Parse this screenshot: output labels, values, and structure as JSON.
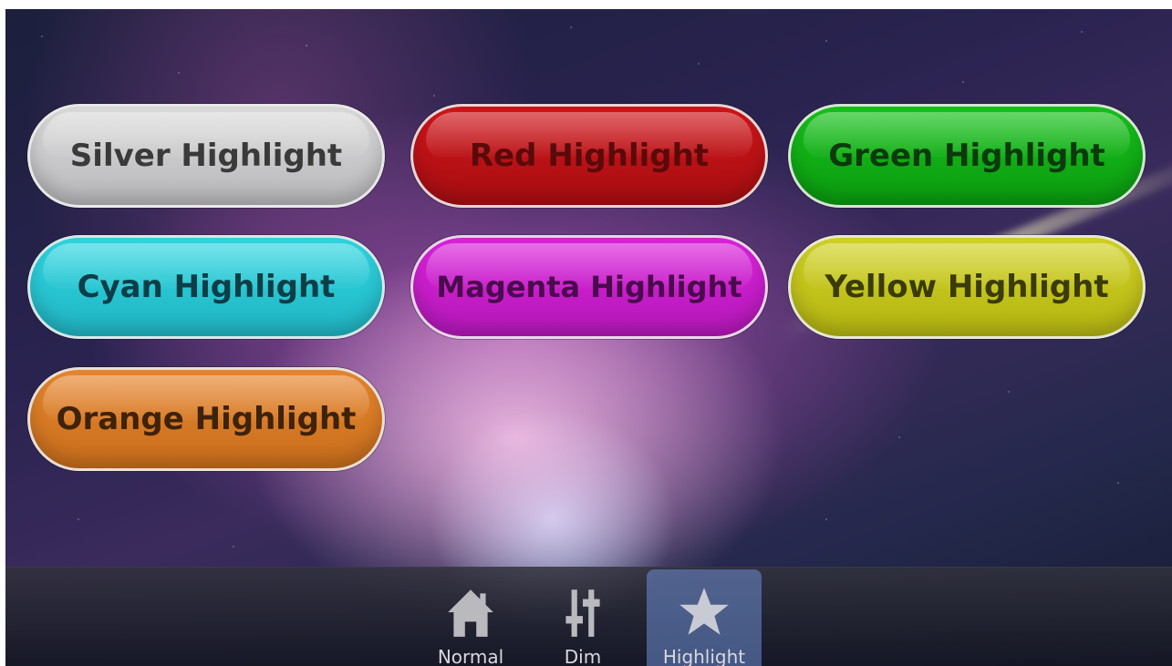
{
  "buttons": [
    {
      "label": "Silver Highlight",
      "color": "#c8c8cc"
    },
    {
      "label": "Red Highlight",
      "color": "#c01116"
    },
    {
      "label": "Green Highlight",
      "color": "#12b016"
    },
    {
      "label": "Cyan Highlight",
      "color": "#27c6d2"
    },
    {
      "label": "Magenta Highlight",
      "color": "#c81dcc"
    },
    {
      "label": "Yellow Highlight",
      "color": "#c3c41b"
    },
    {
      "label": "Orange Highlight",
      "color": "#d97a26"
    }
  ],
  "nav": {
    "tabs": [
      {
        "label": "Normal",
        "icon": "home-icon",
        "active": false
      },
      {
        "label": "Dim",
        "icon": "sliders-icon",
        "active": false
      },
      {
        "label": "Highlight",
        "icon": "star-icon",
        "active": true
      }
    ],
    "active_tab_color": "#6e8cd2"
  }
}
